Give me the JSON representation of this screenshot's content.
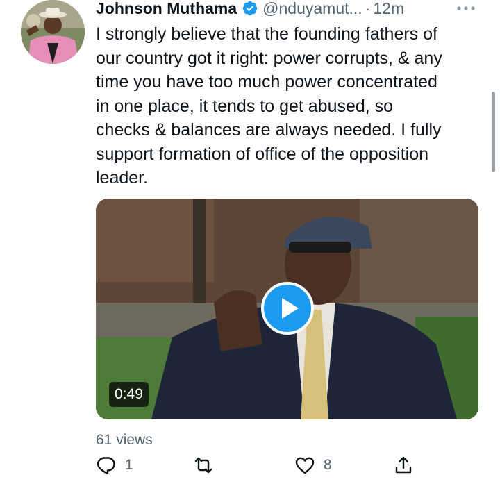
{
  "author": {
    "name": "Johnson Muthama",
    "handle": "@nduyamut...",
    "time": "12m",
    "separator": "·",
    "verified": true
  },
  "tweet": {
    "text": "I strongly believe that the founding fathers of\nour country got it right: power corrupts, & any\ntime you have too much power concentrated\nin one place, it tends to get abused, so\nchecks & balances are always needed. I fully\nsupport  formation of office of the opposition\nleader."
  },
  "media": {
    "type": "video",
    "duration": "0:49"
  },
  "stats": {
    "views": "61 views"
  },
  "actions": {
    "reply_count": "1",
    "retweet_count": "",
    "like_count": "8"
  },
  "colors": {
    "accent": "#1d9bf0",
    "muted_text": "#536471",
    "primary_text": "#0f1419"
  },
  "icons": [
    "verified-badge-icon",
    "more-icon",
    "play-icon",
    "reply-icon",
    "retweet-icon",
    "like-icon",
    "share-icon"
  ]
}
